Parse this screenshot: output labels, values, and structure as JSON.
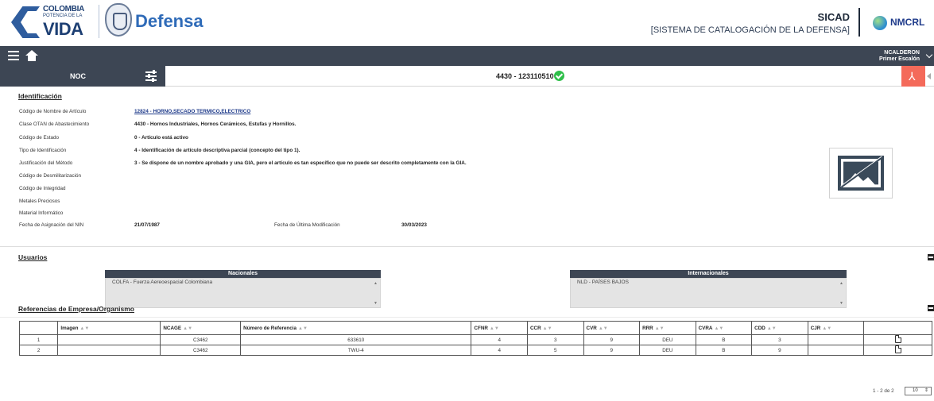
{
  "header": {
    "logo_line1": "COLOMBIA",
    "logo_line2": "POTENCIA DE LA",
    "logo_line3": "VIDA",
    "ministry": "Defensa",
    "app_title": "SICAD",
    "app_subtitle": "[SISTEMA DE CATALOGACIÓN DE LA DEFENSA]",
    "partner_logo": "NMCRL"
  },
  "nav": {
    "user_name": "NCALDERON",
    "user_role": "Primer Escalón"
  },
  "toolbar": {
    "section_label": "NOC",
    "nin": "4430 - 123110510"
  },
  "identification": {
    "title": "Identificación",
    "fields": [
      {
        "label": "Código de Nombre de Artículo",
        "value": "12824 - HORNO,SECADO TERMICO,ELECTRICO"
      },
      {
        "label": "Clase OTAN de Abastecimiento",
        "value": "4430 - Hornos Industriales, Hornos Cerámicos, Estufas y Hornillos."
      },
      {
        "label": "Código de Estado",
        "value": "0 - Artículo está activo"
      },
      {
        "label": "Tipo de Identificación",
        "value": "4 - Identificación de artículo descriptiva parcial (concepto del tipo 1)."
      },
      {
        "label": "Justificación del Método",
        "value": "3 - Se dispone de un nombre aprobado y una GIA, pero el artículo es tan específico que no puede ser descrito completamente con la GIA."
      },
      {
        "label": "Código de Desmilitarización",
        "value": ""
      },
      {
        "label": "Código de Integridad",
        "value": ""
      },
      {
        "label": "Metales Preciosos",
        "value": ""
      },
      {
        "label": "Material Informático",
        "value": ""
      },
      {
        "label": "Fecha de Asignación del NIN",
        "value": "21/07/1987"
      }
    ],
    "last_mod_label": "Fecha de Última Modificación",
    "last_mod_value": "30/03/2023"
  },
  "users": {
    "title": "Usuarios",
    "national_header": "Nacionales",
    "national_items": [
      "COLFA - Fuerza Aereoespacial Colombiana"
    ],
    "international_header": "Internacionales",
    "international_items": [
      "NLD - PAÍSES BAJOS"
    ]
  },
  "references": {
    "title": "Referencias de Empresa/Organismo",
    "columns": [
      "",
      "Imagen",
      "NCAGE",
      "Número de Referencia",
      "CFNR",
      "CCR",
      "CVR",
      "RRR",
      "CVRA",
      "CDD",
      "CJR",
      ""
    ],
    "rows": [
      [
        "1",
        "",
        "C3462",
        "633610",
        "4",
        "3",
        "9",
        "DEU",
        "B",
        "3",
        ""
      ],
      [
        "2",
        "",
        "C3462",
        "TWU-4",
        "4",
        "5",
        "9",
        "DEU",
        "B",
        "9",
        ""
      ]
    ],
    "pager_text": "1 - 2 de 2",
    "page_size": "10"
  },
  "colors": {
    "nav_bg": "#3d4654",
    "brand_blue": "#2f6bb8",
    "check_green": "#2fbf4a",
    "pdf_red": "#f46a5a"
  },
  "icons": [
    "menu-icon",
    "home-icon",
    "sliders-icon",
    "check-circle-icon",
    "pdf-icon",
    "image-placeholder-icon",
    "minus-icon",
    "document-icon"
  ]
}
